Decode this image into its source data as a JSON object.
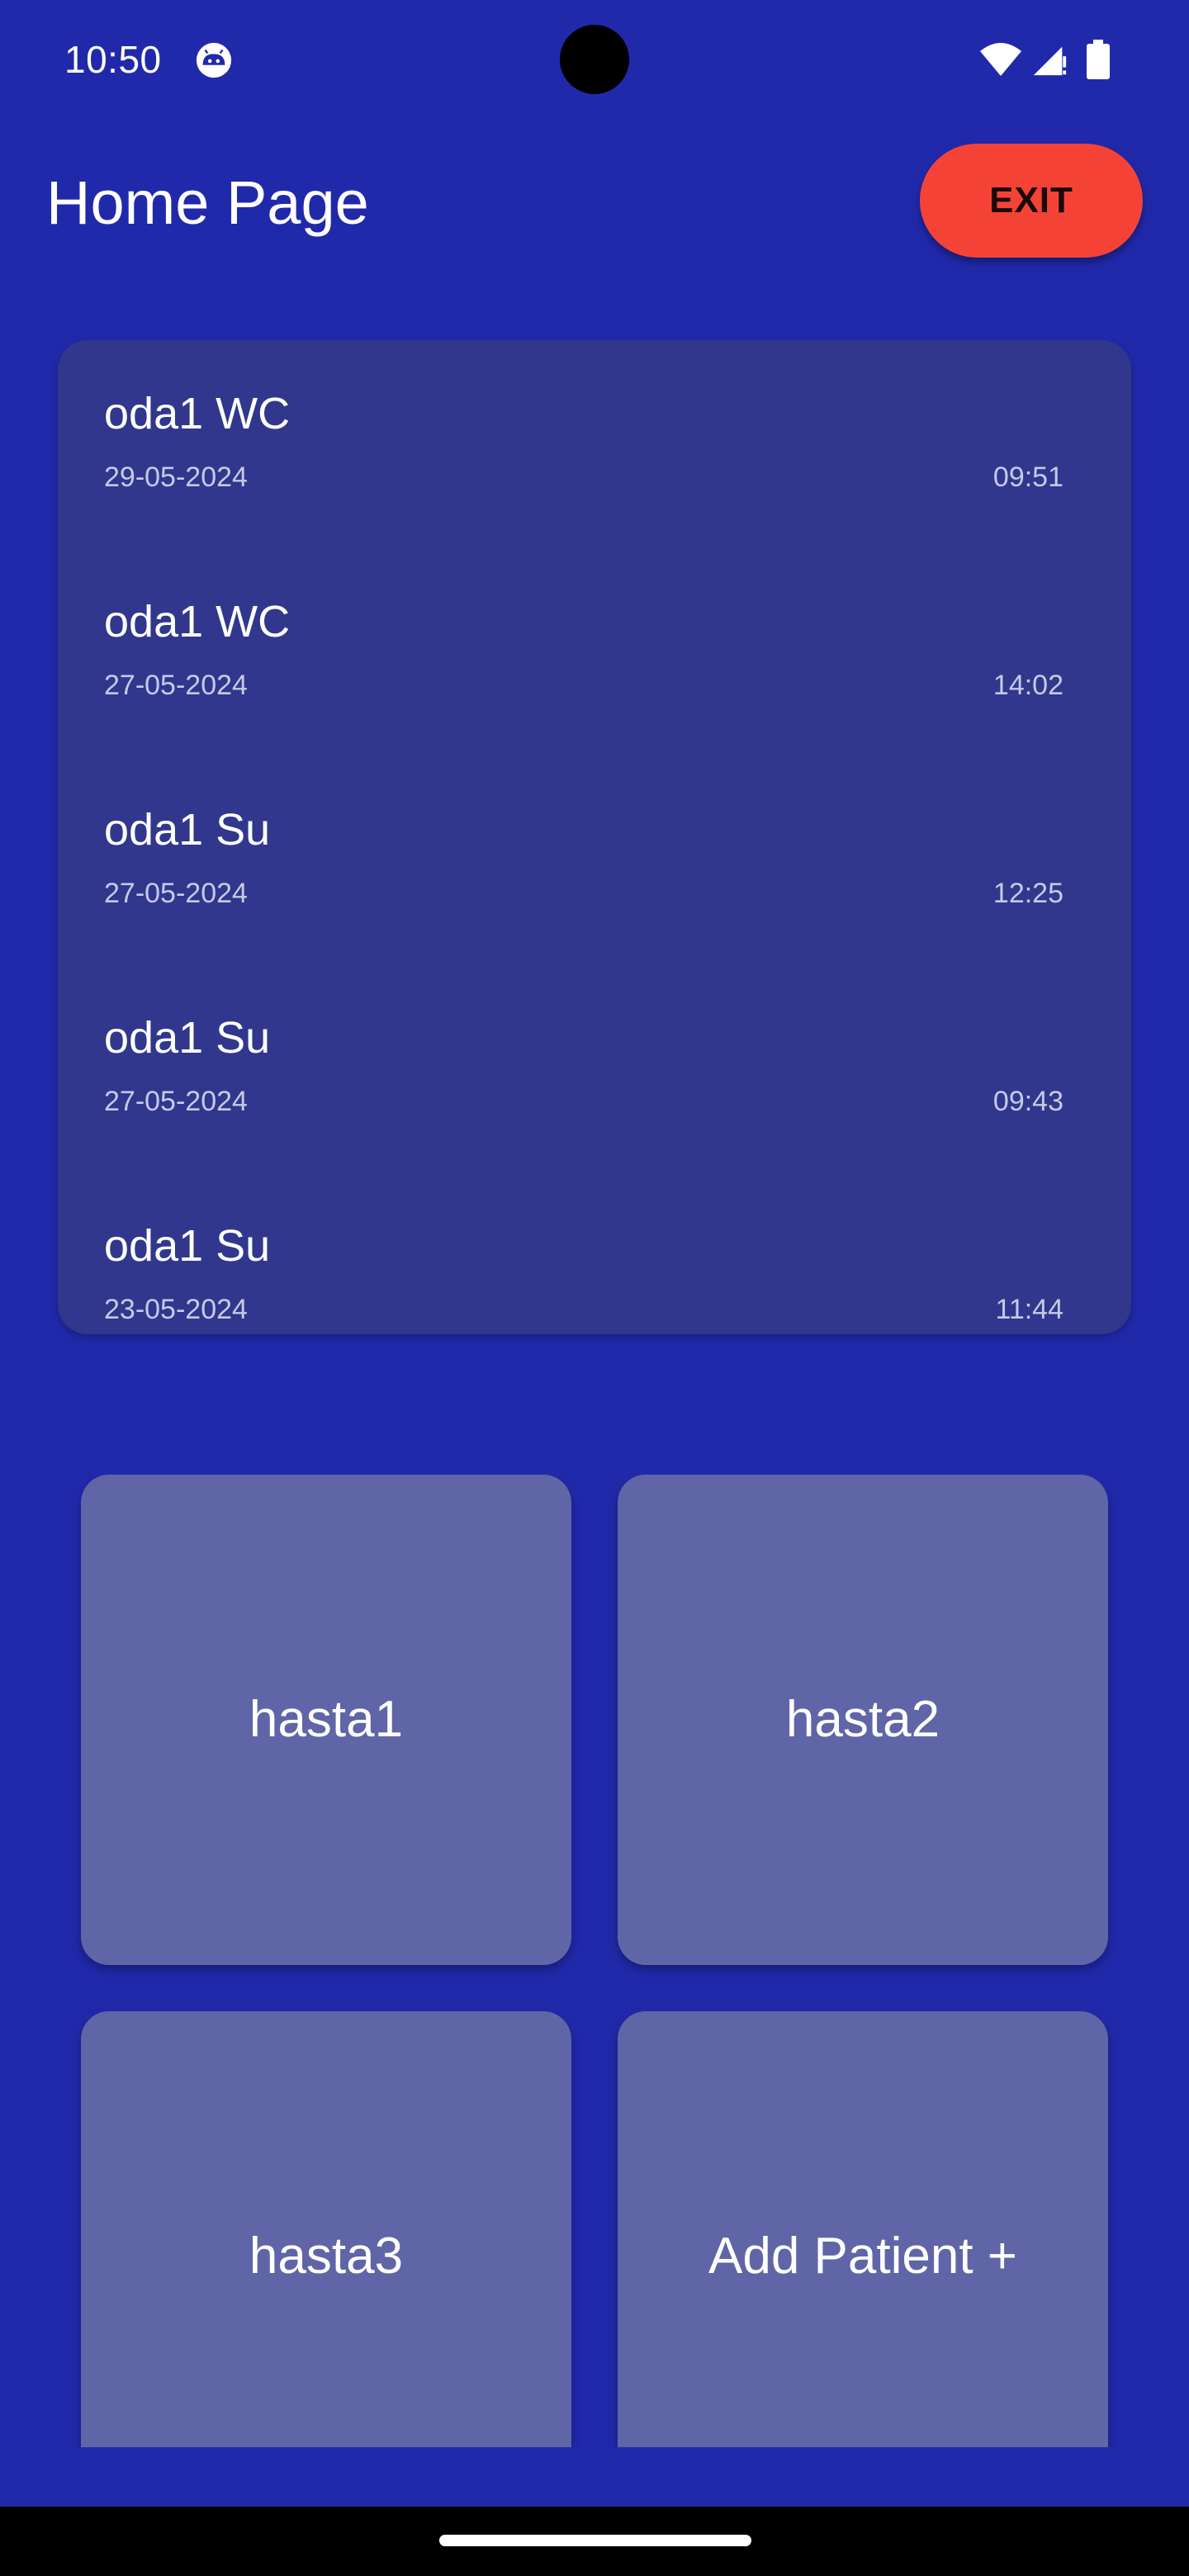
{
  "status_bar": {
    "time": "10:50",
    "app_icon": "android-face-icon",
    "wifi_icon": "wifi-icon",
    "signal_icon": "cell-signal-icon",
    "battery_icon": "battery-icon"
  },
  "header": {
    "title": "Home Page",
    "exit_label": "EXIT"
  },
  "history": {
    "items": [
      {
        "title": "oda1 WC",
        "date": "29-05-2024",
        "time": "09:51"
      },
      {
        "title": "oda1 WC",
        "date": "27-05-2024",
        "time": "14:02"
      },
      {
        "title": "oda1 Su",
        "date": "27-05-2024",
        "time": "12:25"
      },
      {
        "title": "oda1 Su",
        "date": "27-05-2024",
        "time": "09:43"
      },
      {
        "title": "oda1 Su",
        "date": "23-05-2024",
        "time": "11:44"
      }
    ]
  },
  "patients": {
    "tiles": [
      {
        "label": "hasta1"
      },
      {
        "label": "hasta2"
      },
      {
        "label": "hasta3"
      },
      {
        "label": "Add Patient +"
      }
    ]
  },
  "colors": {
    "background": "#2129ab",
    "card": "#30378d",
    "tile": "#5f65a6",
    "exit_button": "#f44336"
  }
}
